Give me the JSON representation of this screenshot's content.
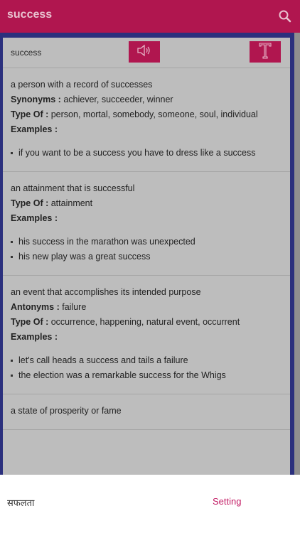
{
  "app": {
    "title": "success",
    "search_icon": "search-icon"
  },
  "header": {
    "word": "success",
    "speaker_icon": "speaker-icon",
    "font_icon": "font-T-icon"
  },
  "entries": [
    {
      "definition": "a person with a record of successes",
      "fields": [
        {
          "label": "Synonyms :",
          "value": "achiever, succeeder, winner"
        },
        {
          "label": "Type Of :",
          "value": "person, mortal, somebody, someone, soul, individual"
        },
        {
          "label": "Examples :",
          "value": ""
        }
      ],
      "examples": [
        "if you want to be a success you have to dress like a success"
      ]
    },
    {
      "definition": "an attainment that is successful",
      "fields": [
        {
          "label": "Type Of :",
          "value": "attainment"
        },
        {
          "label": "Examples :",
          "value": ""
        }
      ],
      "examples": [
        "his success in the marathon was unexpected",
        "his new play was a great success"
      ]
    },
    {
      "definition": "an event that accomplishes its intended purpose",
      "fields": [
        {
          "label": "Antonyms :",
          "value": "failure"
        },
        {
          "label": "Type Of :",
          "value": "occurrence, happening, natural event, occurrent"
        },
        {
          "label": "Examples :",
          "value": ""
        }
      ],
      "examples": [
        "let's call heads a success and tails a failure",
        "the election was a remarkable success for the Whigs"
      ]
    },
    {
      "definition": "a state of prosperity or fame",
      "fields": [],
      "examples": []
    }
  ],
  "bottom": {
    "translation": "सफलता",
    "setting_label": "Setting"
  },
  "colors": {
    "brand": "#b0164f",
    "frame": "#2b307d",
    "panel": "#bdbdbd"
  }
}
